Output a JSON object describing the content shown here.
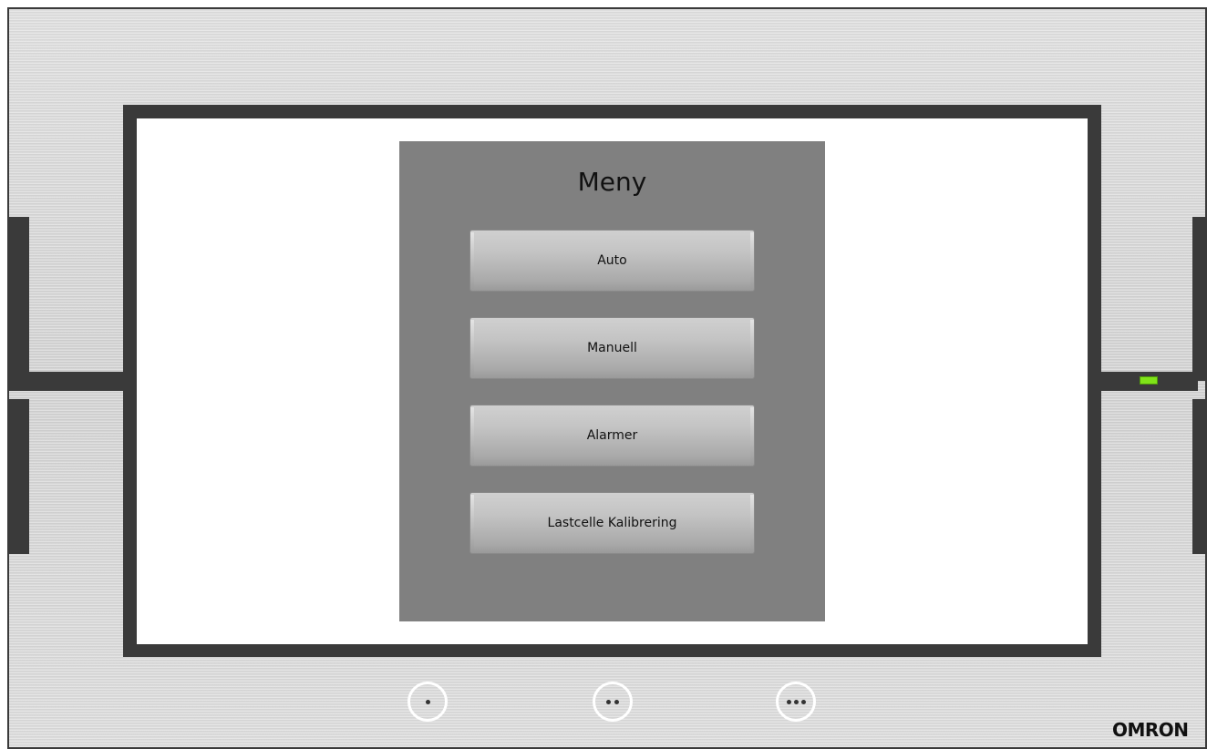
{
  "menu": {
    "title": "Meny",
    "buttons": [
      {
        "label": "Auto"
      },
      {
        "label": "Manuell"
      },
      {
        "label": "Alarmer"
      },
      {
        "label": "Lastcelle Kalibrering"
      }
    ]
  },
  "bezel": {
    "brand": "OMRON",
    "function_keys": [
      {
        "icon": "one-dot-icon",
        "dots": 1
      },
      {
        "icon": "two-dot-icon",
        "dots": 2
      },
      {
        "icon": "three-dot-icon",
        "dots": 3
      }
    ],
    "status_led_color": "#7fe318"
  },
  "colors": {
    "panel_bg": "#808080",
    "frame": "#3a3a3a",
    "screen_bg": "#ffffff"
  }
}
